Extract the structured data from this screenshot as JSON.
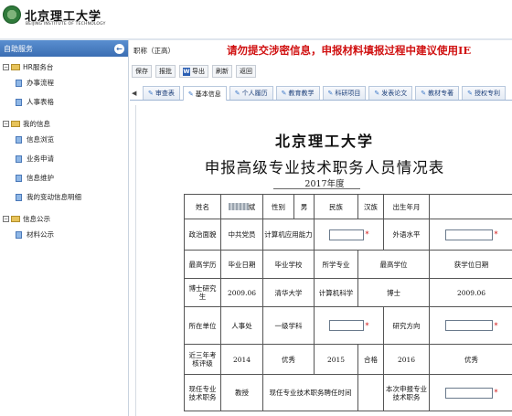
{
  "header": {
    "logo_cn": "北京理工大学",
    "logo_en": "BEIJING INSTITUTE OF TECHNOLOGY"
  },
  "sidebar": {
    "title": "自助服务",
    "groups": [
      {
        "label": "HR服务台",
        "items": [
          "办事流程",
          "人事表格"
        ]
      },
      {
        "label": "我的信息",
        "items": [
          "信息浏览",
          "业务申请",
          "信息维护",
          "我的变动信息明细"
        ]
      },
      {
        "label": "信息公示",
        "items": [
          "材料公示"
        ]
      }
    ]
  },
  "main": {
    "role": "职称（正高）",
    "warning": "请勿提交涉密信息，申报材料填报过程中建议使用IE",
    "toolbar": [
      "保存",
      "报批",
      "导出",
      "刷新",
      "返回"
    ],
    "tabs": [
      "审查表",
      "基本信息",
      "个人履历",
      "教育教学",
      "科研项目",
      "发表论文",
      "教材专著",
      "授权专利"
    ],
    "active_tab": "基本信息",
    "uni_title": "北京理工大学",
    "form_title": "申报高级专业技术职务人员情况表",
    "year": "2017年度"
  },
  "form": {
    "r1": {
      "name_label": "姓名",
      "name_value_suffix": "斌",
      "gender_label": "性别",
      "gender_value": "男",
      "ethnic_label": "民族",
      "ethnic_value": "汉族",
      "birth_label": "出生年月"
    },
    "r2": {
      "politics_label": "政治面貌",
      "politics_value": "中共党员",
      "computer_label": "计算机应用能力",
      "foreign_label": "外语水平"
    },
    "r3": {
      "edu_label": "最高学历",
      "grad_date": "毕业日期",
      "grad_school": "毕业学校",
      "major": "所学专业",
      "degree": "最高学位",
      "degree_date": "获学位日期"
    },
    "r4": {
      "phd_label": "博士研究生",
      "phd_date": "2009.06",
      "phd_school": "清华大学",
      "phd_major": "计算机科学",
      "phd_degree": "博士",
      "phd_degree_date": "2009.06"
    },
    "r5": {
      "unit_label": "所在单位",
      "unit_value": "人事处",
      "discipline_label": "一级学科",
      "research_label": "研究方向"
    },
    "r6": {
      "eval_label": "近三年考核评级",
      "y1": "2014",
      "r1": "优秀",
      "y2": "2015",
      "r2": "合格",
      "y3": "2016",
      "r3": "优秀"
    },
    "r7": {
      "current_label": "现任专业技术职务",
      "current_value": "教授",
      "appoint_label": "现任专业技术职务聘任时间",
      "apply_label": "本次申报专业技术职务"
    }
  }
}
